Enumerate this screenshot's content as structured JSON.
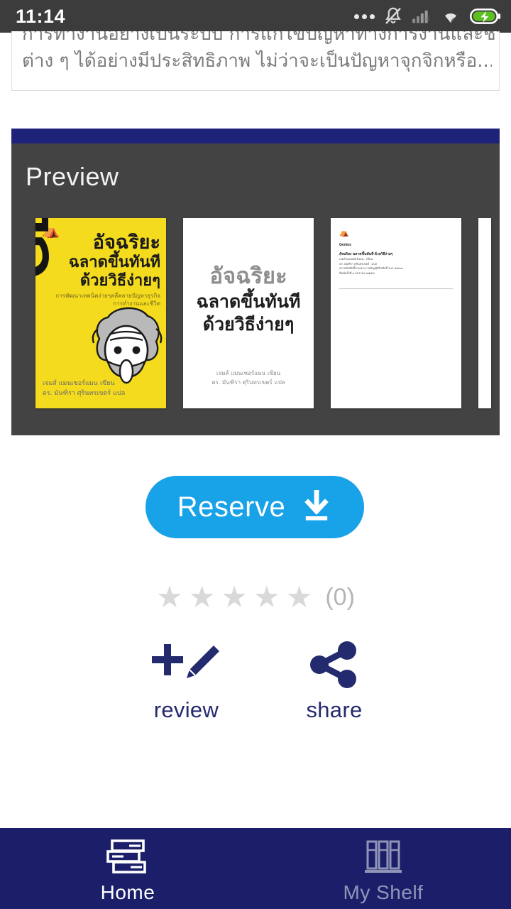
{
  "statusbar": {
    "time": "11:14",
    "icons": [
      {
        "name": "more-dots-icon"
      },
      {
        "name": "bell-muted-icon"
      },
      {
        "name": "signal-no-service-icon"
      },
      {
        "name": "wifi-icon"
      },
      {
        "name": "battery-charging-icon"
      }
    ],
    "background": "#3c3c3c"
  },
  "description": {
    "line1_clipped": "การทำงานอย่างเป็นระบบ การแก้ไขปัญหาทางการงานและชีวิตประจำวัน",
    "line2": "ต่าง ๆ ได้อย่างมีประสิทธิภาพ ไม่ว่าจะเป็นปัญหาจุกจิกหรือ..."
  },
  "preview": {
    "accent_color": "#1e2278",
    "panel_color": "#434343",
    "title": "Preview",
    "pages": [
      {
        "name": "book-cover",
        "type": "cover",
        "background": "#f5db1e",
        "logo": "publisher-crown-logo",
        "vertical_title": "GENIUS",
        "thai_title_line1": "อัจฉริยะ",
        "thai_title_line2": "ฉลาดขึ้นทันที",
        "thai_title_line3": "ด้วยวิธีง่ายๆ",
        "thai_subtitle_line1": "การพัฒนาเทคนิคง่ายๆคลี่คลายปัญหาธุรกิจ",
        "thai_subtitle_line2": "การทำงานและชีวิต",
        "credit_line1": "เจมส์ แมนเซอร์แมน",
        "credit_role1": "เขียน",
        "credit_line2": "ดร. มันฑิรา ศุรินทรเขตร์",
        "credit_role2": "แปล"
      },
      {
        "name": "title-page",
        "type": "title",
        "thai_title_line1": "อัจฉริยะ",
        "thai_title_line2": "ฉลาดขึ้นทันที",
        "thai_title_line3": "ด้วยวิธีง่ายๆ",
        "credit_line1": "เจมส์ แมนเซอร์แมน",
        "credit_role1": "เขียน",
        "credit_line2": "ดร. มันฑิรา ศุรินทรเขตร์",
        "credit_role2": "แปล"
      },
      {
        "name": "copyright-page",
        "type": "text",
        "heading": "Genius",
        "subheading": "อัจฉริยะ ฉลาดขึ้นทันที ด้วยวิธีง่ายๆ",
        "body_lines": [
          "เจมส์ แมนเซอร์แมน : เขียน",
          "ดร. มันฑิรา ศุรินทรเขตร์ : แปล",
          "สงวนลิขสิทธิ์ตามพระราชบัญญัติลิขสิทธิ์ พ.ศ. ๒๕๓๗",
          "พิมพ์ครั้งที่ ๑ มกราคม ๒๕๕๘"
        ]
      },
      {
        "name": "next-page-clipped",
        "type": "clipped"
      }
    ]
  },
  "reserve": {
    "label": "Reserve",
    "icon": "download-icon",
    "color": "#18a2e8"
  },
  "rating": {
    "stars_total": 5,
    "stars_filled": 0,
    "count_label": "(0)",
    "star_color": "#d9d9d9"
  },
  "actions": [
    {
      "name": "review",
      "label": "review",
      "icon": "add-review-pencil-icon"
    },
    {
      "name": "share",
      "label": "share",
      "icon": "share-icon"
    }
  ],
  "bottom_nav": {
    "background": "#1b1f69",
    "items": [
      {
        "name": "home",
        "label": "Home",
        "icon": "stacked-books-icon",
        "active": true
      },
      {
        "name": "my-shelf",
        "label": "My Shelf",
        "icon": "bookshelf-icon",
        "active": false
      }
    ]
  }
}
